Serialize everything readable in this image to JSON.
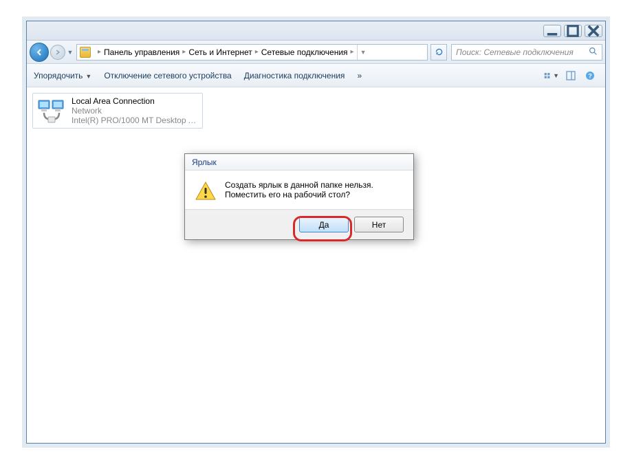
{
  "breadcrumb": {
    "items": [
      "Панель управления",
      "Сеть и Интернет",
      "Сетевые подключения"
    ]
  },
  "search": {
    "placeholder": "Поиск: Сетевые подключения"
  },
  "toolbar": {
    "organize": "Упорядочить",
    "disable": "Отключение сетевого устройства",
    "diagnose": "Диагностика подключения"
  },
  "connection": {
    "name": "Local Area Connection",
    "status": "Network",
    "device": "Intel(R) PRO/1000 MT Desktop Ad..."
  },
  "dialog": {
    "title": "Ярлык",
    "line1": "Создать ярлык в данной папке нельзя.",
    "line2": "Поместить его на рабочий стол?",
    "yes": "Да",
    "no": "Нет"
  }
}
